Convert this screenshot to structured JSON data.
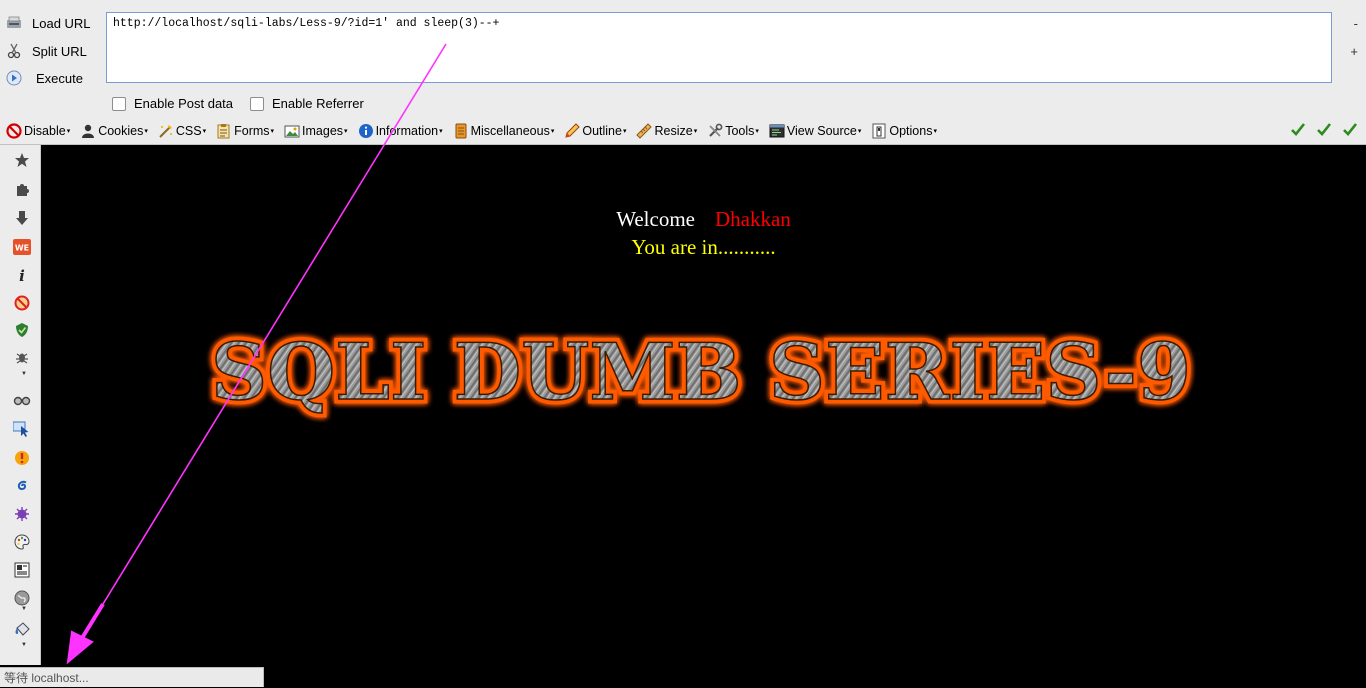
{
  "hackbar": {
    "load_url": "Load URL",
    "split_url": "Split URL",
    "execute": "Execute",
    "url_value": "http://localhost/sqli-labs/Less-9/?id=1' and sleep(3)--+",
    "minus": "-",
    "plus": "+",
    "enable_post": "Enable Post data",
    "enable_referrer": "Enable Referrer"
  },
  "toolbar": {
    "items": [
      {
        "label": "Disable",
        "icon": "disable-icon"
      },
      {
        "label": "Cookies",
        "icon": "cookies-icon"
      },
      {
        "label": "CSS",
        "icon": "css-icon"
      },
      {
        "label": "Forms",
        "icon": "forms-icon"
      },
      {
        "label": "Images",
        "icon": "images-icon"
      },
      {
        "label": "Information",
        "icon": "information-icon"
      },
      {
        "label": "Miscellaneous",
        "icon": "miscellaneous-icon"
      },
      {
        "label": "Outline",
        "icon": "outline-icon"
      },
      {
        "label": "Resize",
        "icon": "resize-icon"
      },
      {
        "label": "Tools",
        "icon": "tools-icon"
      },
      {
        "label": "View Source",
        "icon": "view-source-icon"
      },
      {
        "label": "Options",
        "icon": "options-icon"
      }
    ],
    "status_checks": [
      "css-valid-check-icon",
      "html-valid-check-icon",
      "js-valid-check-icon"
    ]
  },
  "sidebar": {
    "icons": [
      "star-icon",
      "puzzle-icon",
      "download-icon",
      "web-developer-icon",
      "info-icon",
      "no-script-icon",
      "shield-icon",
      "bug-icon",
      "glasses-icon",
      "cursor-icon",
      "firebug-icon",
      "swirl-icon",
      "virus-icon",
      "palette-icon",
      "layout-icon",
      "globe-icon",
      "bucket-icon"
    ]
  },
  "page": {
    "welcome": "Welcome",
    "name": "Dhakkan",
    "you_are_in": "You are in...........",
    "banner": "SQLI DUMB SERIES-9"
  },
  "status_bar": "等待 localhost...",
  "colors": {
    "page_bg": "#000000",
    "welcome": "#ffffff",
    "name": "#ff0000",
    "you_are_in": "#ffff00",
    "banner_glow": "#ff5a00",
    "annotation_arrow": "#ff33ff"
  }
}
